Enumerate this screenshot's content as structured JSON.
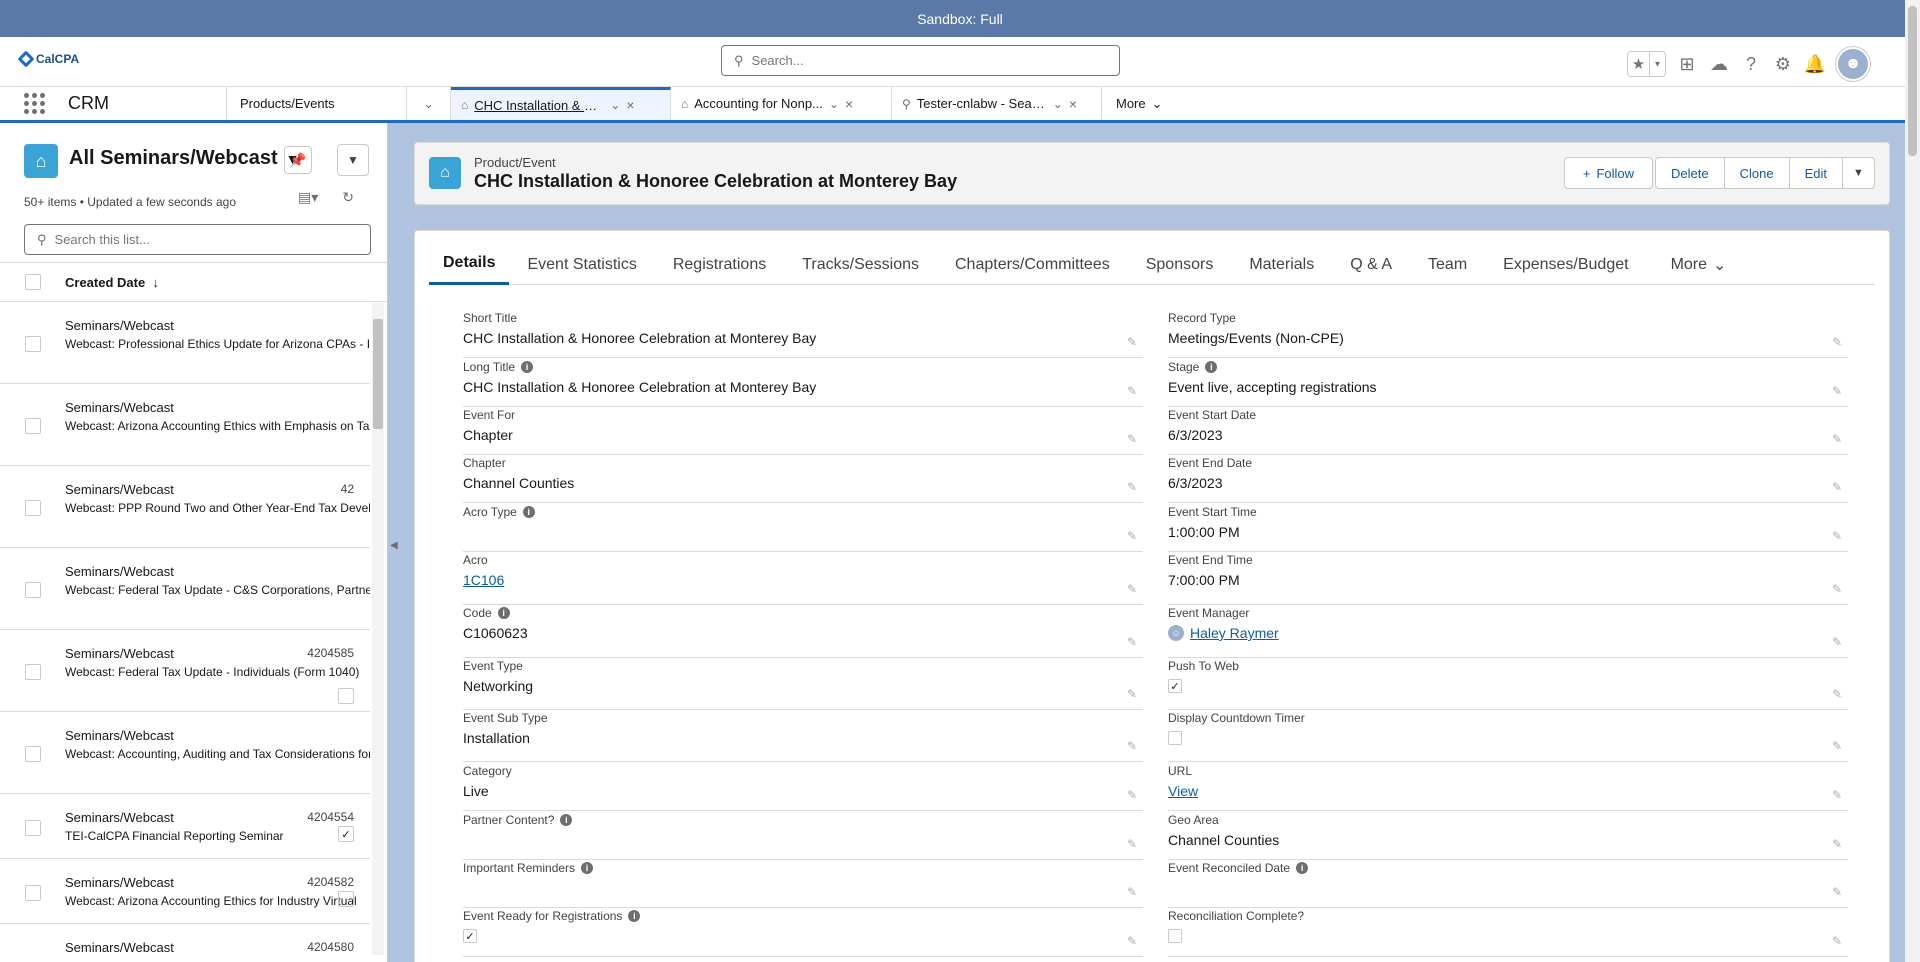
{
  "sandbox": {
    "label": "Sandbox: Full"
  },
  "header": {
    "logo_text": "CalCPA",
    "search_placeholder": "Search..."
  },
  "nav": {
    "app_name": "CRM",
    "products_label": "Products/Events",
    "tabs": [
      {
        "label": "CHC Installation & H...",
        "icon": "product-event-icon",
        "active": true
      },
      {
        "label": "Accounting for Nonp...",
        "icon": "product-event-icon",
        "active": false
      },
      {
        "label": "Tester-cnlabw - Search",
        "icon": "search-icon",
        "active": false
      }
    ],
    "more_label": "More"
  },
  "list": {
    "title": "All Seminars/Webcast",
    "meta": "50+ items • Updated a few seconds ago",
    "search_placeholder": "Search this list...",
    "sort_column": "Created Date",
    "rows": [
      {
        "type": "Seminars/Webcast",
        "num": "",
        "name": "Webcast: Professional Ethics Update for Arizona CPAs - Indi",
        "checked": null
      },
      {
        "type": "Seminars/Webcast",
        "num": "",
        "name": "Webcast: Arizona Accounting Ethics with Emphasis on Tax",
        "checked": null
      },
      {
        "type": "Seminars/Webcast",
        "num": "42",
        "name": "Webcast: PPP Round Two and Other Year-End Tax Develop",
        "checked": null
      },
      {
        "type": "Seminars/Webcast",
        "num": "",
        "name": "Webcast: Federal Tax Update - C&S Corporations, Partners",
        "checked": null
      },
      {
        "type": "Seminars/Webcast",
        "num": "4204585",
        "name": "Webcast: Federal Tax Update - Individuals (Form 1040)",
        "checked": false
      },
      {
        "type": "Seminars/Webcast",
        "num": "",
        "name": "Webcast: Accounting, Auditing and Tax Considerations for",
        "checked": null
      },
      {
        "type": "Seminars/Webcast",
        "num": "4204554",
        "name": "TEI-CalCPA Financial Reporting Seminar",
        "checked": true
      },
      {
        "type": "Seminars/Webcast",
        "num": "4204582",
        "name": "Webcast: Arizona Accounting Ethics for Industry Virtual",
        "checked": false
      },
      {
        "type": "Seminars/Webcast",
        "num": "4204580",
        "name": "",
        "checked": null
      }
    ]
  },
  "record": {
    "object_label": "Product/Event",
    "title": "CHC Installation & Honoree Celebration at Monterey Bay",
    "actions": {
      "follow": "Follow",
      "delete": "Delete",
      "clone": "Clone",
      "edit": "Edit"
    },
    "tabs": [
      "Details",
      "Event Statistics",
      "Registrations",
      "Tracks/Sessions",
      "Chapters/Committees",
      "Sponsors",
      "Materials",
      "Q & A",
      "Team",
      "Expenses/Budget"
    ],
    "tabs_more": "More",
    "left_fields": [
      {
        "label": "Short Title",
        "value": "CHC Installation & Honoree Celebration at Monterey Bay",
        "info": false
      },
      {
        "label": "Long Title",
        "value": "CHC Installation & Honoree Celebration at Monterey Bay",
        "info": true
      },
      {
        "label": "Event For",
        "value": "Chapter",
        "info": false
      },
      {
        "label": "Chapter",
        "value": "Channel Counties",
        "info": false
      },
      {
        "label": "Acro Type",
        "value": "",
        "info": true
      },
      {
        "label": "Acro",
        "value": "1C106",
        "info": false,
        "link": true
      },
      {
        "label": "Code",
        "value": "C1060623",
        "info": true
      },
      {
        "label": "Event Type",
        "value": "Networking",
        "info": false
      },
      {
        "label": "Event Sub Type",
        "value": "Installation",
        "info": false
      },
      {
        "label": "Category",
        "value": "Live",
        "info": false
      },
      {
        "label": "Partner Content?",
        "value": "",
        "info": true
      },
      {
        "label": "Important Reminders",
        "value": "",
        "info": true
      },
      {
        "label": "Event Ready for Registrations",
        "value": "",
        "info": true,
        "checkbox": true,
        "checked": true
      }
    ],
    "right_fields": [
      {
        "label": "Record Type",
        "value": "Meetings/Events (Non-CPE)",
        "info": false
      },
      {
        "label": "Stage",
        "value": "Event live, accepting registrations",
        "info": true
      },
      {
        "label": "Event Start Date",
        "value": "6/3/2023",
        "info": false
      },
      {
        "label": "Event End Date",
        "value": "6/3/2023",
        "info": false
      },
      {
        "label": "Event Start Time",
        "value": "1:00:00 PM",
        "info": false
      },
      {
        "label": "Event End Time",
        "value": "7:00:00 PM",
        "info": false
      },
      {
        "label": "Event Manager",
        "value": "Haley Raymer",
        "info": false,
        "link": true,
        "avatar": true
      },
      {
        "label": "Push To Web",
        "value": "",
        "info": false,
        "checkbox": true,
        "checked": true
      },
      {
        "label": "Display Countdown Timer",
        "value": "",
        "info": false,
        "checkbox": true,
        "checked": false
      },
      {
        "label": "URL",
        "value": "View",
        "info": false,
        "link": true
      },
      {
        "label": "Geo Area",
        "value": "Channel Counties",
        "info": false
      },
      {
        "label": "Event Reconciled Date",
        "value": "",
        "info": true
      },
      {
        "label": "Reconciliation Complete?",
        "value": "",
        "info": false,
        "checkbox": true,
        "checked": false
      }
    ]
  }
}
